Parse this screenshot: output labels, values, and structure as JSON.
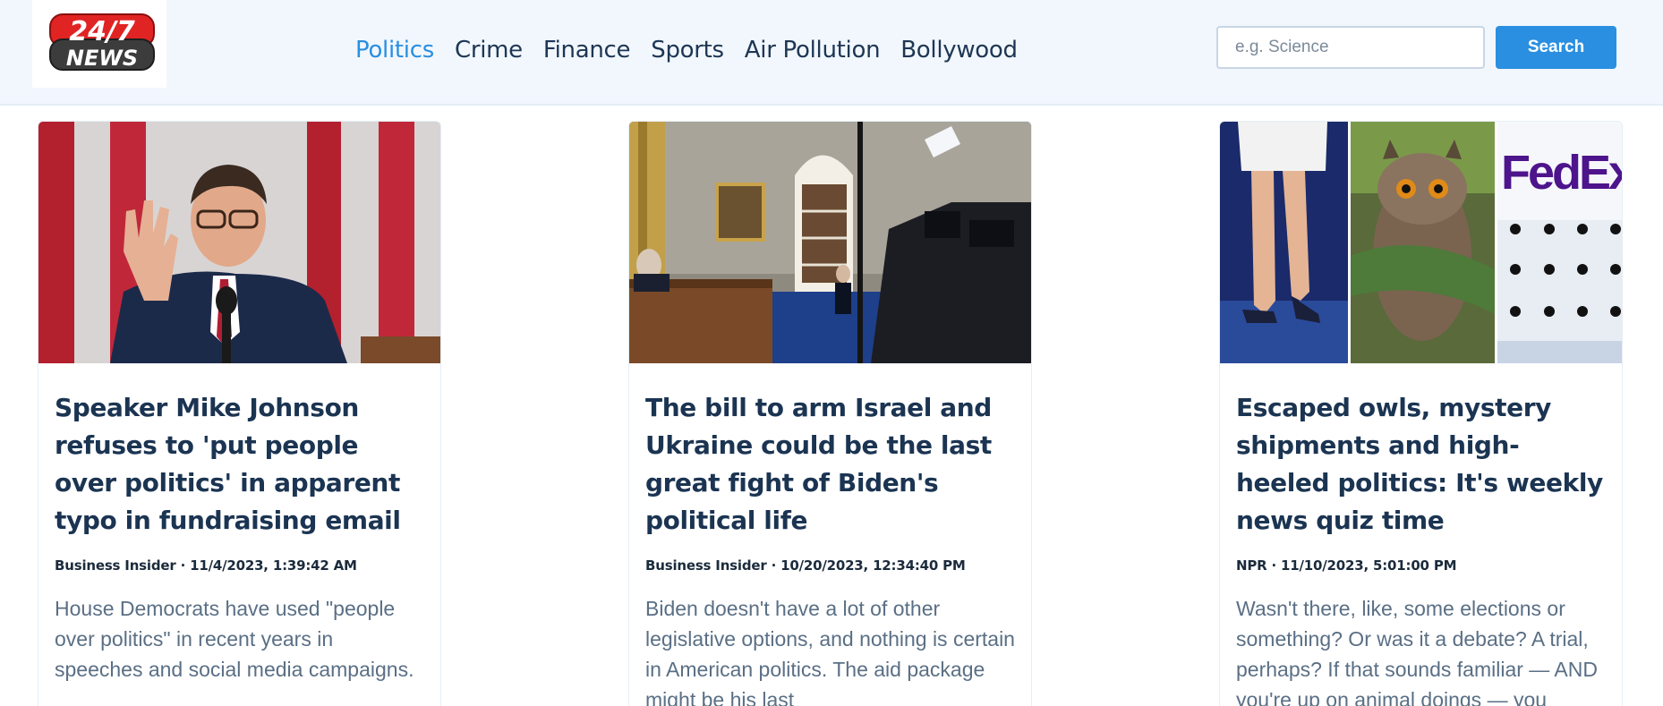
{
  "logo": {
    "line1": "24/7",
    "line2": "NEWS"
  },
  "nav": {
    "items": [
      {
        "label": "Politics",
        "active": true
      },
      {
        "label": "Crime",
        "active": false
      },
      {
        "label": "Finance",
        "active": false
      },
      {
        "label": "Sports",
        "active": false
      },
      {
        "label": "Air Pollution",
        "active": false
      },
      {
        "label": "Bollywood",
        "active": false
      }
    ]
  },
  "search": {
    "placeholder": "e.g. Science",
    "value": "",
    "button_label": "Search"
  },
  "articles": [
    {
      "title": "Speaker Mike Johnson refuses to 'put people over politics' in apparent typo in fundraising email",
      "source": "Business Insider",
      "date": "11/4/2023, 1:39:42 AM",
      "meta": "Business Insider · 11/4/2023, 1:39:42 AM",
      "description": "House Democrats have used \"people over politics\" in recent years in speeches and social media campaigns."
    },
    {
      "title": "The bill to arm Israel and Ukraine could be the last great fight of Biden's political life",
      "source": "Business Insider",
      "date": "10/20/2023, 12:34:40 PM",
      "meta": "Business Insider · 10/20/2023, 12:34:40 PM",
      "description": "Biden doesn't have a lot of other legislative options, and nothing is certain in American politics. The aid package might be his last"
    },
    {
      "title": "Escaped owls, mystery shipments and high-heeled politics: It's weekly news quiz time",
      "source": "NPR",
      "date": "11/10/2023, 5:01:00 PM",
      "meta": "NPR · 11/10/2023, 5:01:00 PM",
      "description": "Wasn't there, like, some elections or something? Or was it a debate? A trial, perhaps? If that sounds familiar — AND you're up on animal doings — you"
    }
  ],
  "image_text": {
    "fedex": "FedEx"
  },
  "colors": {
    "accent": "#2a8fe0",
    "nav_text": "#1e3654",
    "title_text": "#1b3452",
    "description_text": "#5a6f85",
    "header_bg": "#f1f7fd",
    "logo_red": "#e02424"
  }
}
